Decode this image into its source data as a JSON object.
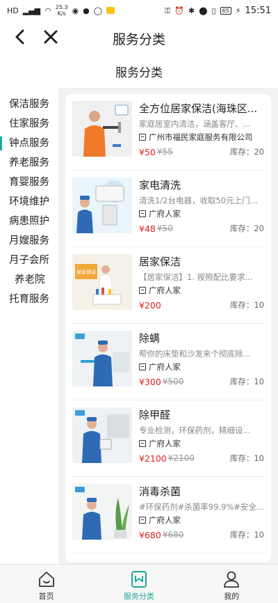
{
  "status_bar": {
    "network_speed": "25.3",
    "speed_unit": "K/s",
    "battery": "65",
    "time": "15:51"
  },
  "header": {
    "title": "服务分类"
  },
  "subtitle": "服务分类",
  "sidebar": {
    "items": [
      {
        "label": "保洁服务",
        "active": false
      },
      {
        "label": "住家服务",
        "active": false
      },
      {
        "label": "钟点服务",
        "active": true
      },
      {
        "label": "养老服务",
        "active": false
      },
      {
        "label": "育婴服务",
        "active": false
      },
      {
        "label": "环境维护",
        "active": false
      },
      {
        "label": "病患照护",
        "active": false
      },
      {
        "label": "月嫂服务",
        "active": false
      },
      {
        "label": "月子会所",
        "active": false
      },
      {
        "label": "养老院",
        "active": false
      },
      {
        "label": "托育服务",
        "active": false
      }
    ]
  },
  "products": [
    {
      "title": "全方位居家保洁(海珠区...",
      "desc": "家庭居室内清洁，涵盖客厅、...",
      "shop": "广州市福民家庭服务有限公司",
      "price": "¥50",
      "old_price": "¥55",
      "stock": "库存：20"
    },
    {
      "title": "家电清洗",
      "desc": "清洗1/2台电器，收取50元上门...",
      "shop": "广府人家",
      "price": "¥48",
      "old_price": "¥50",
      "stock": "库存：20"
    },
    {
      "title": "居家保洁",
      "desc": "【居家保洁】1. 按照配比要求...",
      "shop": "广府人家",
      "price": "¥200",
      "old_price": "",
      "stock": "库存：10"
    },
    {
      "title": "除螨",
      "desc": "帮你的床垫和沙发来个彻底除...",
      "shop": "广府人家",
      "price": "¥300",
      "old_price": "¥500",
      "stock": "库存：10"
    },
    {
      "title": "除甲醛",
      "desc": "专业检测，环保药剂，精细设...",
      "shop": "广府人家",
      "price": "¥2100",
      "old_price": "¥2100",
      "stock": "库存：10"
    },
    {
      "title": "消毒杀菌",
      "desc": "#环保药剂#杀菌率99.9%#安全...",
      "shop": "广府人家",
      "price": "¥680",
      "old_price": "¥680",
      "stock": "库存：10"
    }
  ],
  "thumb_text": {
    "p3": "居家保洁"
  },
  "tabbar": {
    "items": [
      {
        "label": "首页",
        "icon": "home-icon",
        "active": false
      },
      {
        "label": "服务分类",
        "icon": "bookmark-icon",
        "active": true
      },
      {
        "label": "我的",
        "icon": "user-icon",
        "active": false
      }
    ]
  },
  "colors": {
    "accent": "#1ea79c",
    "price": "#e02020",
    "panel_bg": "#f2f2f2"
  }
}
